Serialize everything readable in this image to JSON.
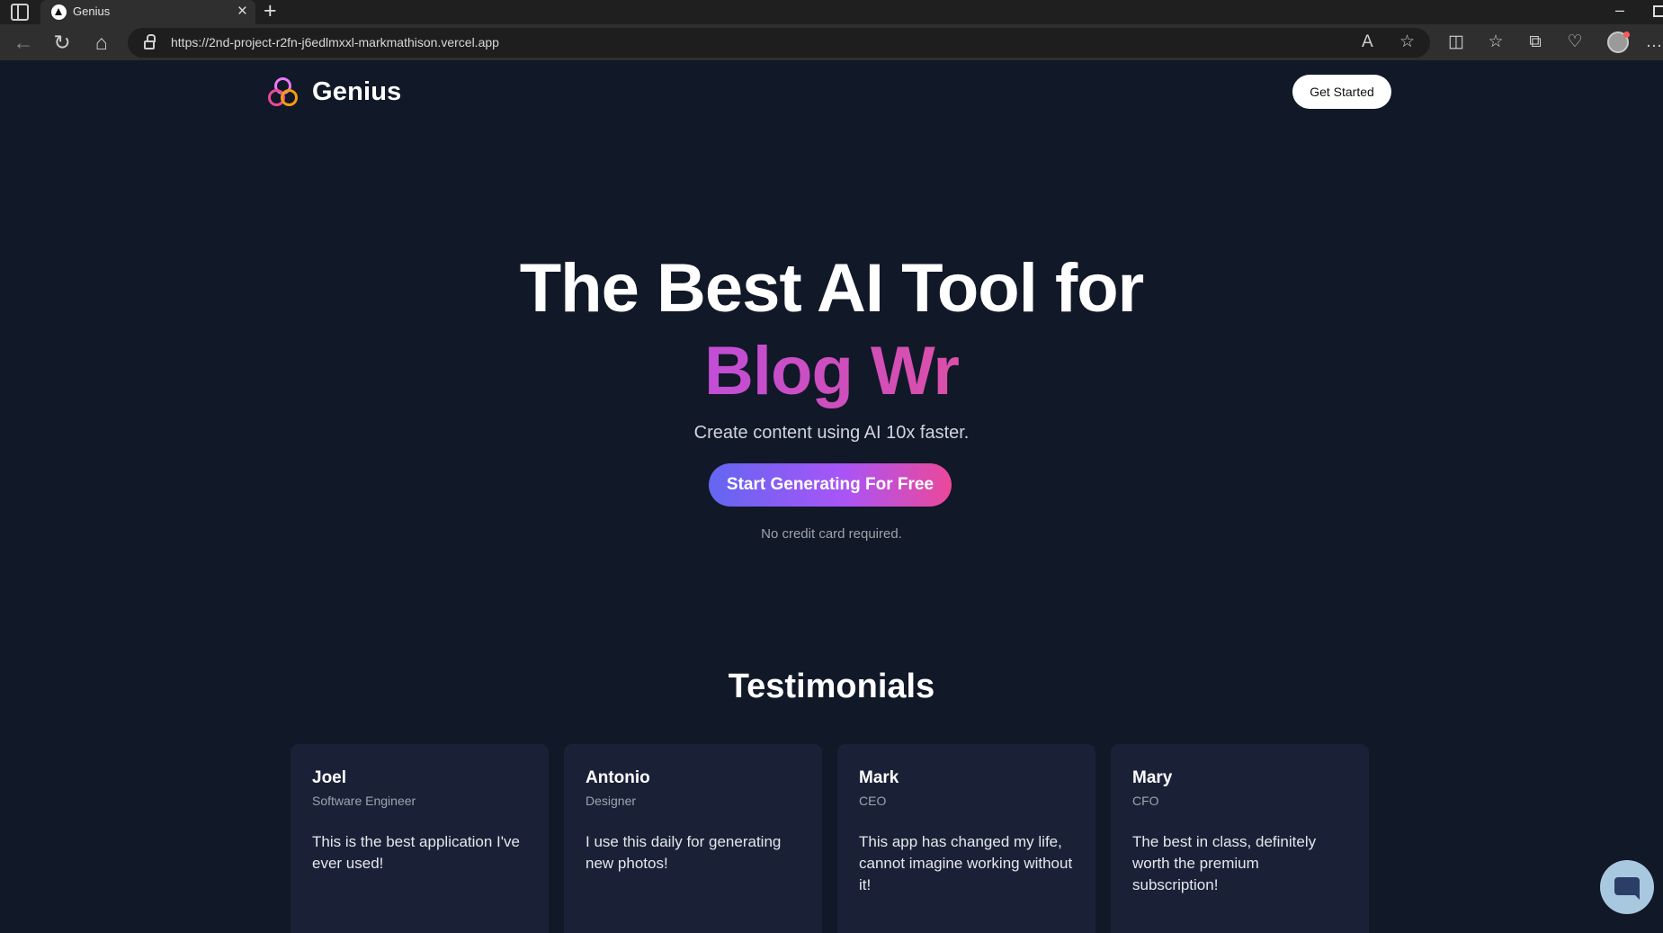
{
  "browser": {
    "tab_title": "Genius",
    "url": "https://2nd-project-r2fn-j6edlmxxl-markmathison.vercel.app"
  },
  "nav": {
    "brand": "Genius",
    "cta_label": "Get Started"
  },
  "hero": {
    "line1": "The Best AI Tool for",
    "line2": "Blog Wr",
    "subtitle": "Create content using AI 10x faster.",
    "cta_label": "Start Generating For Free",
    "note": "No credit card required."
  },
  "testimonials": {
    "title": "Testimonials",
    "items": [
      {
        "name": "Joel",
        "role": "Software Engineer",
        "text": "This is the best application I've ever used!"
      },
      {
        "name": "Antonio",
        "role": "Designer",
        "text": "I use this daily for generating new photos!"
      },
      {
        "name": "Mark",
        "role": "CEO",
        "text": "This app has changed my life, cannot imagine working without it!"
      },
      {
        "name": "Mary",
        "role": "CFO",
        "text": "The best in class, definitely worth the premium subscription!"
      }
    ]
  },
  "colors": {
    "background": "#111827",
    "card": "#1a2137",
    "accent_gradient_start": "#6366f1",
    "accent_gradient_end": "#ec4899"
  }
}
